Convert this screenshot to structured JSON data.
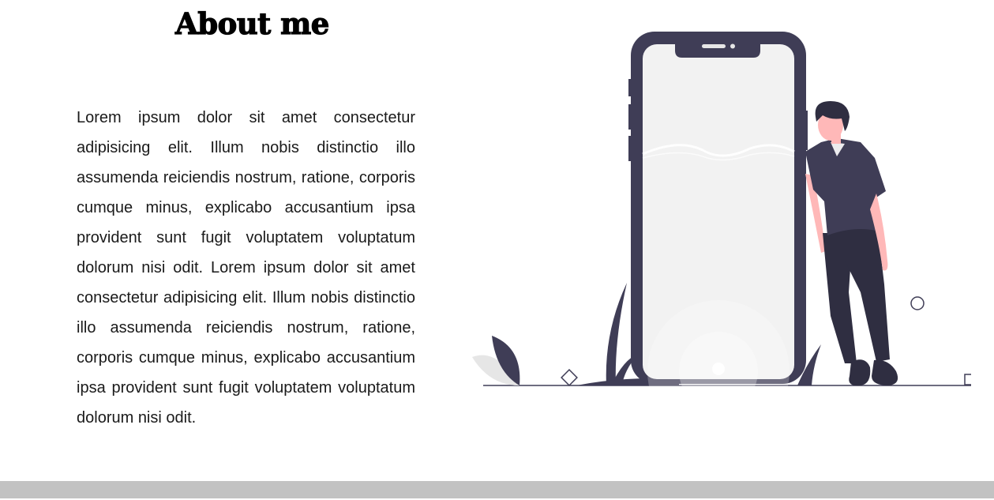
{
  "about": {
    "title": "About me",
    "paragraph": "Lorem ipsum dolor sit amet consectetur adipisicing elit. Illum nobis distinctio illo assumenda reiciendis nostrum, ratione, corporis cumque minus, explicabo accusantium ipsa provident sunt fugit voluptatem voluptatum dolorum nisi odit. Lorem ipsum dolor sit amet consectetur adipisicing elit. Illum nobis distinctio illo assumenda reiciendis nostrum, ratione, corporis cumque minus, explicabo accusantium ipsa provident sunt fugit voluptatem voluptatum dolorum nisi odit."
  },
  "illustration": {
    "subject": "person-leaning-on-phone",
    "colors": {
      "phone": "#3f3d56",
      "screen": "#f2f2f2",
      "skin": "#ffb8b8",
      "hair": "#2f2e41",
      "pants": "#2f2e41",
      "shirt": "#3f3d56"
    }
  },
  "footer": {
    "color": "#c2c2c2"
  }
}
